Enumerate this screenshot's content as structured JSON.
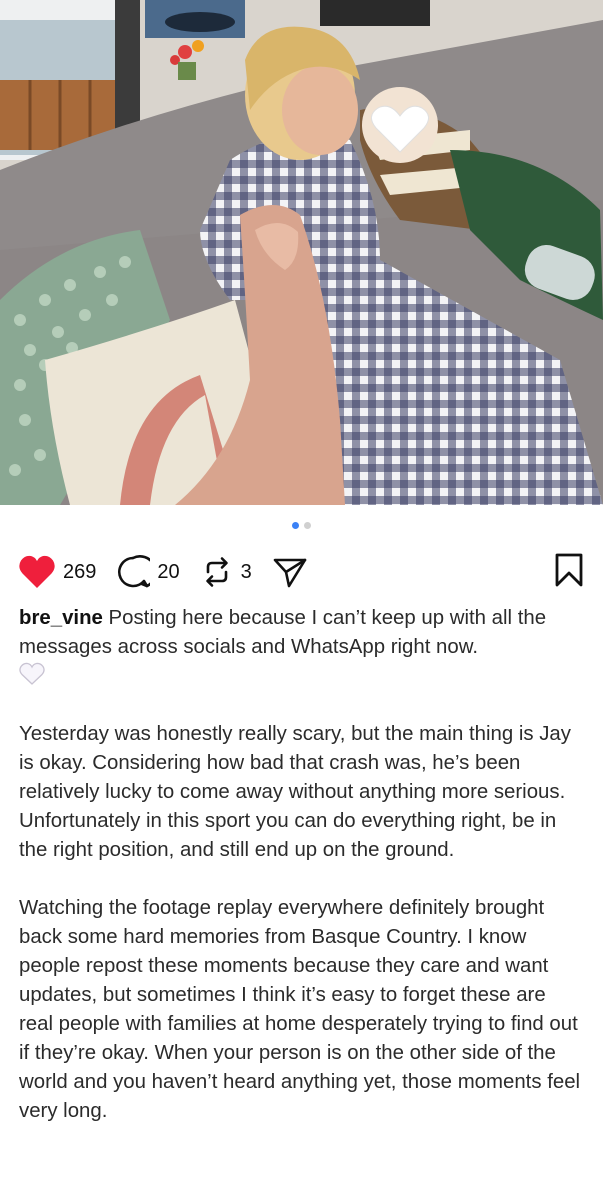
{
  "post": {
    "carousel": {
      "total": 2,
      "active_index": 0
    },
    "actions": {
      "likes": "269",
      "comments": "20",
      "reposts": "3"
    },
    "caption": {
      "username": "bre_vine",
      "intro": "Posting here because I can’t keep up with all the messages across socials and WhatsApp right now.",
      "emoji": "white-heart-emoji",
      "paragraph_2": "Yesterday was honestly really scary, but the main thing is Jay is okay. Considering how bad that crash was, he’s been relatively lucky to come away without anything more serious. Unfortunately in this sport you can do everything right, be in the right position, and still end up on the ground.",
      "paragraph_3": "Watching the footage replay everywhere definitely brought back some hard memories from Basque Country. I know people repost these moments because they care and want updates, but sometimes I think it’s easy to forget these are real people with families at home desperately trying to find out if they’re okay. When your person is on the other side of the world and you haven’t heard anything yet, those moments feel very long."
    },
    "colors": {
      "like_red": "#ef1f3c",
      "carousel_active": "#3b82f6",
      "text": "#2b2b2b"
    }
  }
}
